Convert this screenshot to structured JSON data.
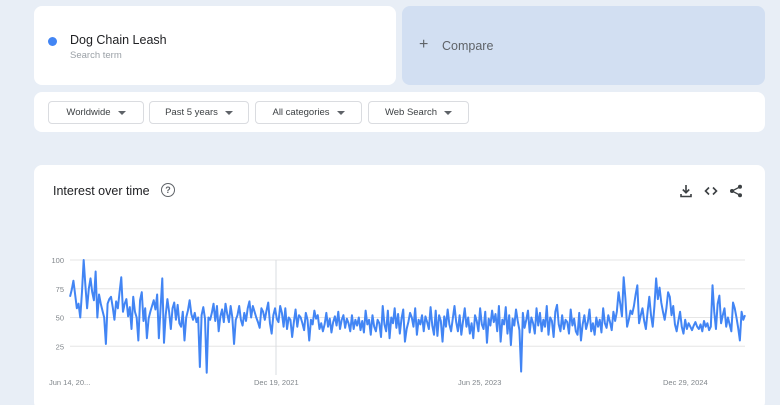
{
  "search_term": {
    "name": "Dog Chain Leash",
    "subtitle": "Search term",
    "color": "#4285f4"
  },
  "compare": {
    "plus": "+",
    "label": "Compare"
  },
  "filters": [
    {
      "label": "Worldwide"
    },
    {
      "label": "Past 5 years"
    },
    {
      "label": "All categories"
    },
    {
      "label": "Web Search"
    }
  ],
  "chart": {
    "title": "Interest over time",
    "help": "?",
    "actions": [
      "download-icon",
      "embed-icon",
      "share-icon"
    ]
  },
  "chart_data": {
    "type": "line",
    "y_ticks": [
      "100",
      "75",
      "50",
      "25"
    ],
    "ylim": [
      0,
      100
    ],
    "x_ticks": [
      "Jun 14, 20...",
      "Dec 19, 2021",
      "Jun 25, 2023",
      "Dec 29, 2024"
    ],
    "grid": true,
    "line_color": "#4285f4",
    "series": [
      {
        "values": [
          68,
          74,
          82,
          70,
          58,
          62,
          50,
          72,
          100,
          78,
          58,
          75,
          84,
          72,
          65,
          90,
          50,
          70,
          62,
          56,
          50,
          27,
          62,
          66,
          68,
          59,
          48,
          64,
          58,
          72,
          85,
          55,
          62,
          66,
          51,
          59,
          40,
          68,
          55,
          50,
          30,
          65,
          72,
          47,
          58,
          32,
          49,
          55,
          60,
          65,
          57,
          70,
          32,
          58,
          84,
          28,
          52,
          66,
          55,
          40,
          58,
          63,
          48,
          61,
          45,
          42,
          55,
          30,
          50,
          56,
          65,
          53,
          48,
          54,
          46,
          50,
          7,
          52,
          59,
          49,
          2,
          50,
          48,
          54,
          62,
          47,
          60,
          38,
          51,
          57,
          46,
          62,
          53,
          46,
          60,
          50,
          27,
          48,
          52,
          60,
          48,
          43,
          54,
          47,
          58,
          64,
          50,
          60,
          55,
          50,
          46,
          41,
          58,
          55,
          48,
          56,
          63,
          45,
          36,
          52,
          58,
          49,
          46,
          60,
          54,
          42,
          58,
          40,
          50,
          48,
          33,
          46,
          57,
          42,
          52,
          50,
          45,
          39,
          54,
          48,
          30,
          48,
          44,
          56,
          49,
          52,
          40,
          45,
          38,
          44,
          54,
          42,
          49,
          37,
          46,
          51,
          43,
          55,
          40,
          48,
          52,
          41,
          49,
          45,
          38,
          52,
          40,
          48,
          43,
          50,
          39,
          47,
          37,
          56,
          44,
          48,
          35,
          52,
          42,
          38,
          48,
          45,
          33,
          60,
          44,
          38,
          56,
          32,
          50,
          45,
          58,
          41,
          53,
          36,
          49,
          57,
          29,
          40,
          46,
          54,
          50,
          42,
          58,
          35,
          48,
          44,
          52,
          38,
          51,
          46,
          40,
          59,
          43,
          35,
          56,
          34,
          52,
          47,
          29,
          51,
          42,
          57,
          44,
          38,
          49,
          60,
          46,
          38,
          52,
          35,
          47,
          58,
          42,
          50,
          36,
          45,
          32,
          52,
          47,
          38,
          58,
          44,
          40,
          55,
          28,
          49,
          43,
          56,
          46,
          53,
          38,
          60,
          29,
          48,
          44,
          59,
          36,
          52,
          26,
          49,
          43,
          57,
          47,
          39,
          3,
          54,
          41,
          48,
          56,
          37,
          50,
          45,
          36,
          58,
          43,
          54,
          38,
          48,
          42,
          60,
          35,
          50,
          47,
          33,
          55,
          61,
          44,
          38,
          52,
          40,
          48,
          46,
          36,
          57,
          43,
          49,
          38,
          35,
          54,
          30,
          44,
          52,
          40,
          46,
          57,
          38,
          45,
          35,
          50,
          42,
          48,
          37,
          58,
          45,
          41,
          52,
          46,
          39,
          55,
          47,
          55,
          72,
          62,
          51,
          85,
          67,
          42,
          48,
          56,
          53,
          60,
          70,
          78,
          45,
          52,
          58,
          47,
          40,
          55,
          68,
          52,
          42,
          60,
          84,
          66,
          76,
          63,
          55,
          48,
          58,
          72,
          68,
          52,
          60,
          44,
          38,
          47,
          55,
          42,
          36,
          48,
          40,
          45,
          42,
          39,
          43,
          46,
          42,
          40,
          44,
          38,
          47,
          42,
          45,
          39,
          42,
          78,
          55,
          40,
          62,
          69,
          45,
          52,
          58,
          42,
          50,
          44,
          38,
          63,
          58,
          50,
          41,
          30,
          55,
          48,
          52
        ]
      }
    ]
  }
}
